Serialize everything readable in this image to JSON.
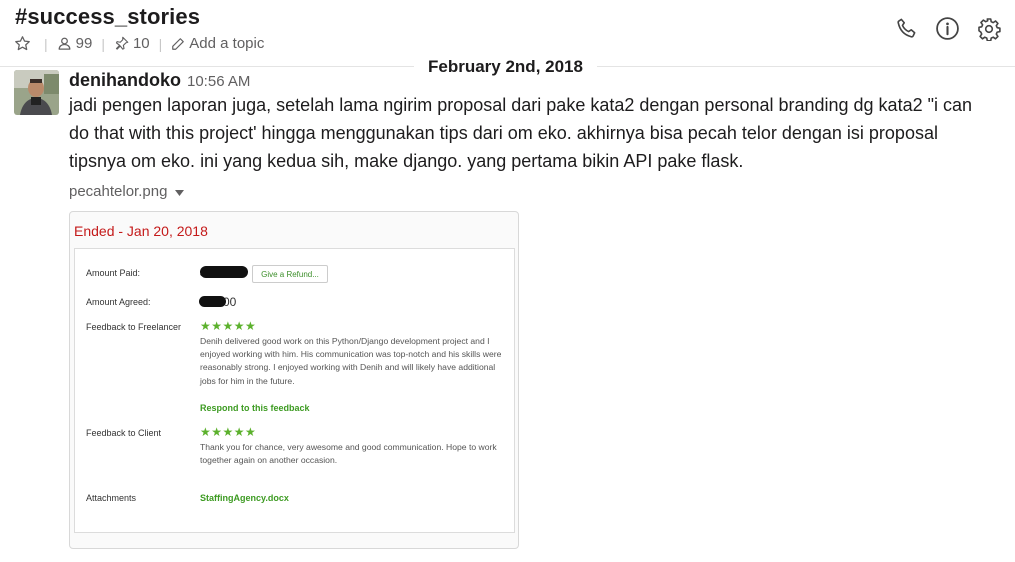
{
  "channel": {
    "name": "#success_stories",
    "member_count": "99",
    "pinned_count": "10",
    "topic_placeholder": "Add a topic"
  },
  "icons": {
    "star": "star-icon",
    "members": "person-icon",
    "pins": "pin-icon",
    "edit": "pencil-icon",
    "call": "phone-icon",
    "info": "info-icon",
    "settings": "gear-icon",
    "file_menu": "caret-down-icon"
  },
  "date_divider": "February 2nd, 2018",
  "message": {
    "author": "denihandoko",
    "time": "10:56 AM",
    "text": "jadi pengen laporan juga, setelah lama ngirim proposal dari pake kata2 dengan personal branding dg kata2 \"i can do that with this project' hingga menggunakan tips dari om eko. akhirnya bisa pecah telor dengan isi proposal tipsnya om eko. ini yang kedua sih, make django. yang pertama bikin API pake flask.",
    "file_name": "pecahtelor.png"
  },
  "attachment": {
    "status": "Ended - Jan 20, 2018",
    "amount_paid_label": "Amount Paid:",
    "amount_paid_value": "$",
    "refund_button": "Give a Refund...",
    "amount_agreed_label": "Amount Agreed:",
    "amount_agreed_value": "00",
    "feedback_freelancer_label": "Feedback to Freelancer",
    "feedback_freelancer_stars": "★★★★★",
    "feedback_freelancer_text": "Denih delivered good work on this Python/Django development project and I enjoyed working with him. His communication was top-notch and his skills were reasonably strong. I enjoyed working with Denih and will likely have additional jobs for him in the future.",
    "respond_link": "Respond to this feedback",
    "feedback_client_label": "Feedback to Client",
    "feedback_client_stars": "★★★★★",
    "feedback_client_text": "Thank you for chance, very awesome and good communication. Hope to work together again on another occasion.",
    "attachments_label": "Attachments",
    "attachment_file": "StaffingAgency.docx"
  },
  "colors": {
    "status_red": "#c41a1a",
    "star_green": "#5cb12d",
    "link_green": "#3d9b22"
  }
}
